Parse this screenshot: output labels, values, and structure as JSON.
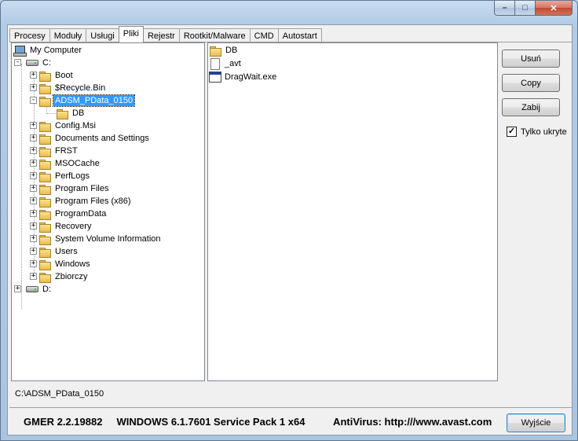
{
  "window": {
    "controls": {
      "minimize_icon": "minimize-icon",
      "maximize_icon": "maximize-icon",
      "close_icon": "close-icon"
    }
  },
  "tabs": [
    {
      "label": "Procesy",
      "active": false
    },
    {
      "label": "Moduły",
      "active": false
    },
    {
      "label": "Usługi",
      "active": false
    },
    {
      "label": "Pliki",
      "active": true
    },
    {
      "label": "Rejestr",
      "active": false
    },
    {
      "label": "Rootkit/Malware",
      "active": false
    },
    {
      "label": "CMD",
      "active": false
    },
    {
      "label": "Autostart",
      "active": false
    }
  ],
  "tree": {
    "root": "My Computer",
    "drive_c": "C:",
    "drive_d": "D:",
    "selected": "ADSM_PData_0150",
    "items": [
      {
        "label": "Boot"
      },
      {
        "label": "$Recycle.Bin"
      },
      {
        "label": "ADSM_PData_0150",
        "expanded": true,
        "children": [
          {
            "label": "DB"
          }
        ]
      },
      {
        "label": "Config.Msi"
      },
      {
        "label": "Documents and Settings"
      },
      {
        "label": "FRST"
      },
      {
        "label": "MSOCache"
      },
      {
        "label": "PerfLogs"
      },
      {
        "label": "Program Files"
      },
      {
        "label": "Program Files (x86)"
      },
      {
        "label": "ProgramData"
      },
      {
        "label": "Recovery"
      },
      {
        "label": "System Volume Information"
      },
      {
        "label": "Users"
      },
      {
        "label": "Windows"
      },
      {
        "label": "Zbiorczy"
      }
    ]
  },
  "files": [
    {
      "name": "DB",
      "icon": "folder-icon"
    },
    {
      "name": "_avt",
      "icon": "file-icon"
    },
    {
      "name": "DragWait.exe",
      "icon": "exe-icon"
    }
  ],
  "actions": {
    "delete_label": "Usuń",
    "copy_label": "Copy",
    "kill_label": "Zabij",
    "hidden_only_label": "Tylko ukryte",
    "hidden_only_checked": true
  },
  "path_label": "C:\\ADSM_PData_0150",
  "status": {
    "text": "GMER 2.2.19882     WINDOWS 6.1.7601 Service Pack 1 x64          AntiVirus: http:///www.avast.com",
    "exit_label": "Wyjście"
  }
}
